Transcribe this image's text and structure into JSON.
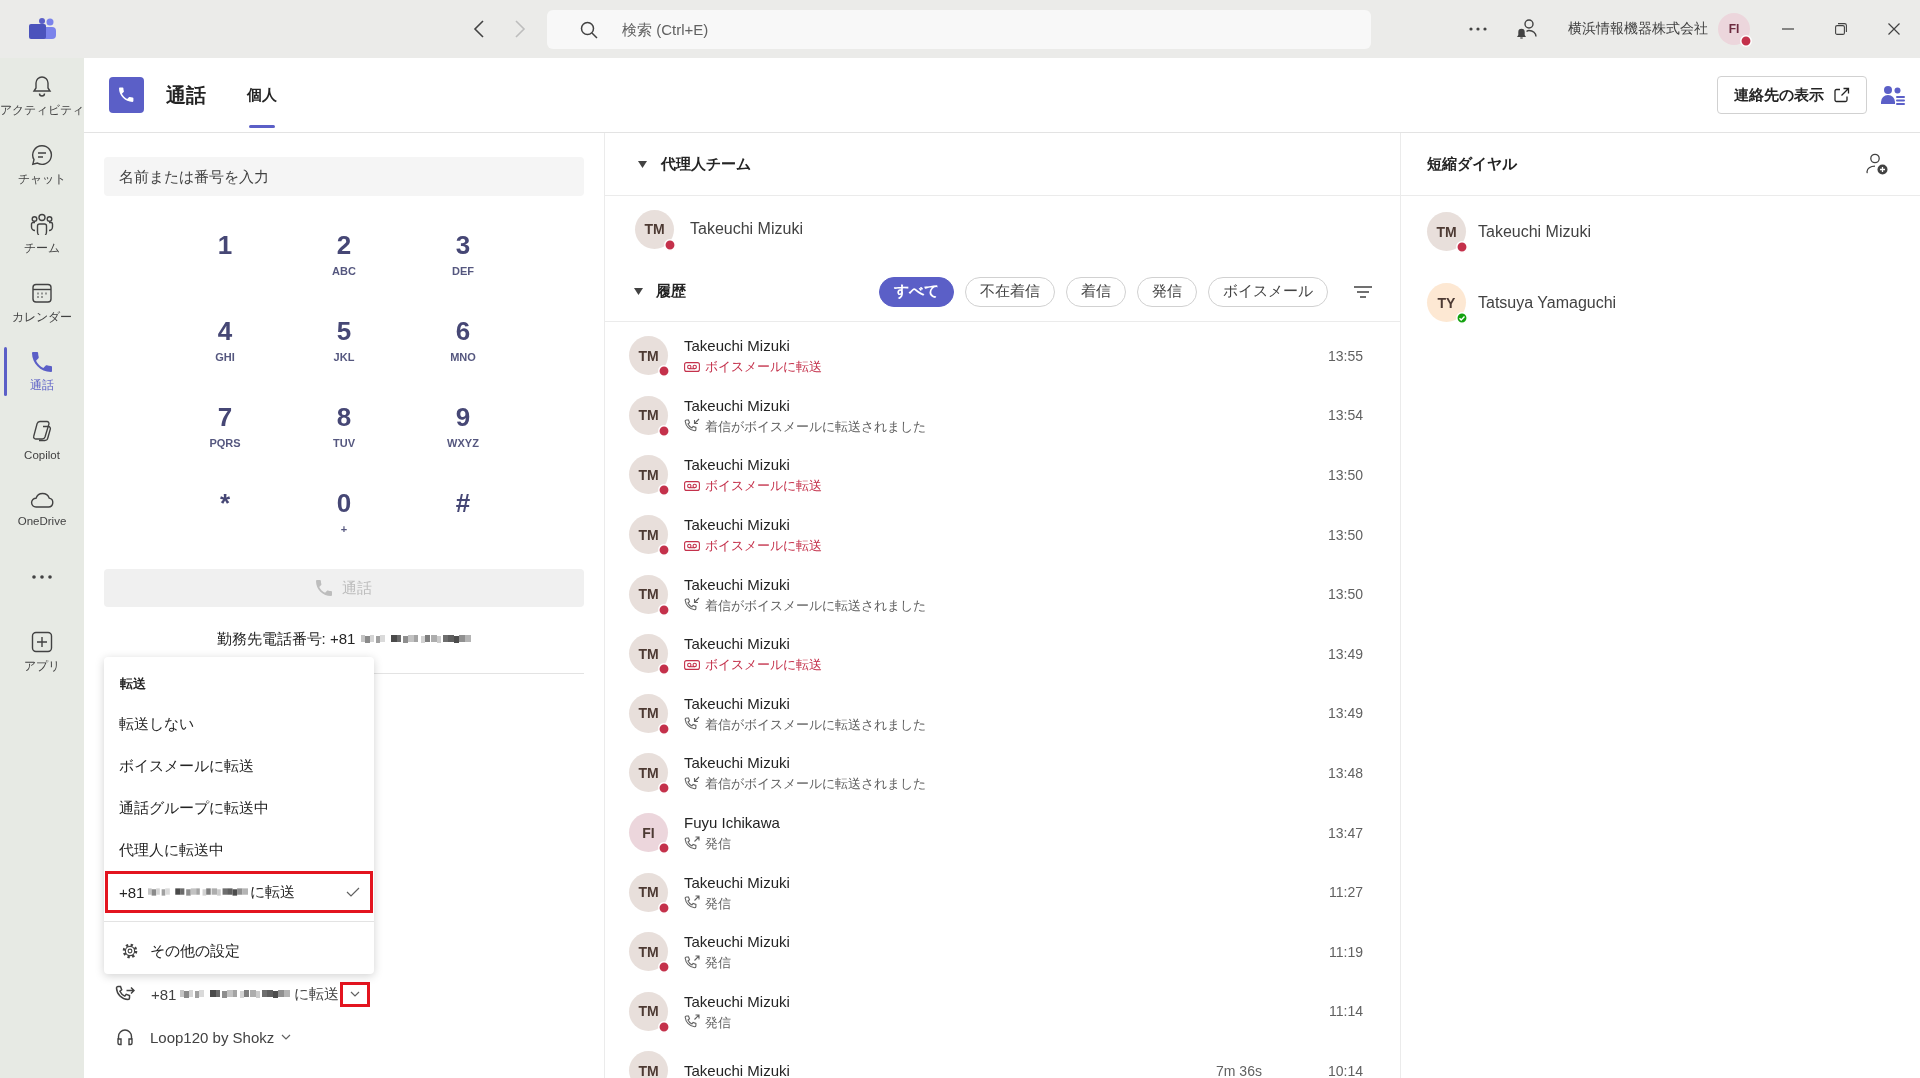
{
  "title_bar": {
    "search_placeholder": "検索 (Ctrl+E)",
    "org_name": "横浜情報機器株式会社",
    "user": {
      "avatar": {
        "initials": "FI",
        "color": "#ecd6dc"
      },
      "status": {
        "color": "#c4314b",
        "available": false
      }
    }
  },
  "app_rail": [
    {
      "kind": "activity",
      "label": "アクティビティ",
      "selected": false
    },
    {
      "kind": "chat",
      "label": "チャット",
      "selected": false
    },
    {
      "kind": "teams",
      "label": "チーム",
      "selected": false
    },
    {
      "kind": "calendar",
      "label": "カレンダー",
      "selected": false
    },
    {
      "kind": "calls",
      "label": "通話",
      "selected": true
    },
    {
      "kind": "copilot",
      "label": "Copilot",
      "selected": false
    },
    {
      "kind": "onedrive",
      "label": "OneDrive",
      "selected": false
    },
    {
      "kind": "more",
      "selected": false
    },
    {
      "kind": "apps",
      "label": "アプリ",
      "selected": false
    }
  ],
  "header": {
    "title": "通話",
    "tabs": [
      {
        "label": "個人",
        "selected": true
      }
    ],
    "contacts_button": "連絡先の表示"
  },
  "dialer": {
    "placeholder": "名前または番号を入力",
    "keys": [
      {
        "digit": "1"
      },
      {
        "digit": "2",
        "letters": "ABC"
      },
      {
        "digit": "3",
        "letters": "DEF"
      },
      {
        "digit": "4",
        "letters": "GHI"
      },
      {
        "digit": "5",
        "letters": "JKL"
      },
      {
        "digit": "6",
        "letters": "MNO"
      },
      {
        "digit": "7",
        "letters": "PQRS"
      },
      {
        "digit": "8",
        "letters": "TUV"
      },
      {
        "digit": "9",
        "letters": "WXYZ"
      },
      {
        "digit": "*"
      },
      {
        "digit": "0",
        "letters": "+"
      },
      {
        "digit": "#"
      }
    ],
    "call_button": {
      "label": "通話",
      "disabled": true
    },
    "work_number": "勤務先電話番号: +81"
  },
  "forward_menu": {
    "title": "転送",
    "items": [
      {
        "kind": "text",
        "label": "転送しない",
        "selected": false,
        "highlighted": false
      },
      {
        "kind": "text",
        "label": "ボイスメールに転送",
        "selected": false,
        "highlighted": false
      },
      {
        "kind": "text",
        "label": "通話グループに転送中",
        "selected": false,
        "highlighted": false
      },
      {
        "kind": "text",
        "label": "代理人に転送中",
        "selected": false,
        "highlighted": false
      },
      {
        "kind": "number",
        "label": "+81",
        "suffix": "に転送",
        "selected": true,
        "highlighted": true
      }
    ],
    "settings": "その他の設定"
  },
  "forwarding": {
    "label": "+81",
    "suffix": "に転送",
    "highlighted": true
  },
  "audio_device": "Loop120 by Shokz",
  "delegates": {
    "title": "代理人チーム",
    "expanded": true,
    "people": [
      {
        "avatar": {
          "initials": "TM",
          "color": "#e8dfdb"
        },
        "name": "Takeuchi Mizuki",
        "status": {
          "color": "#c4314b",
          "available": false
        }
      }
    ]
  },
  "history": {
    "title": "履歴",
    "expanded": true,
    "filters": [
      {
        "label": "すべて",
        "selected": true
      },
      {
        "label": "不在着信",
        "selected": false
      },
      {
        "label": "着信",
        "selected": false
      },
      {
        "label": "発信",
        "selected": false
      },
      {
        "label": "ボイスメール",
        "selected": false
      }
    ],
    "calls": [
      {
        "avatar": {
          "initials": "TM",
          "color": "#e8dfdb"
        },
        "name": "Takeuchi Mizuki",
        "status": {
          "color": "#c4314b",
          "available": false
        },
        "kind": "voicemail",
        "detail": "ボイスメールに転送",
        "time": "13:55"
      },
      {
        "avatar": {
          "initials": "TM",
          "color": "#e8dfdb"
        },
        "name": "Takeuchi Mizuki",
        "status": {
          "color": "#c4314b",
          "available": false
        },
        "kind": "forwarded",
        "detail": "着信がボイスメールに転送されました",
        "time": "13:54"
      },
      {
        "avatar": {
          "initials": "TM",
          "color": "#e8dfdb"
        },
        "name": "Takeuchi Mizuki",
        "status": {
          "color": "#c4314b",
          "available": false
        },
        "kind": "voicemail",
        "detail": "ボイスメールに転送",
        "time": "13:50"
      },
      {
        "avatar": {
          "initials": "TM",
          "color": "#e8dfdb"
        },
        "name": "Takeuchi Mizuki",
        "status": {
          "color": "#c4314b",
          "available": false
        },
        "kind": "voicemail",
        "detail": "ボイスメールに転送",
        "time": "13:50"
      },
      {
        "avatar": {
          "initials": "TM",
          "color": "#e8dfdb"
        },
        "name": "Takeuchi Mizuki",
        "status": {
          "color": "#c4314b",
          "available": false
        },
        "kind": "forwarded",
        "detail": "着信がボイスメールに転送されました",
        "time": "13:50"
      },
      {
        "avatar": {
          "initials": "TM",
          "color": "#e8dfdb"
        },
        "name": "Takeuchi Mizuki",
        "status": {
          "color": "#c4314b",
          "available": false
        },
        "kind": "voicemail",
        "detail": "ボイスメールに転送",
        "time": "13:49"
      },
      {
        "avatar": {
          "initials": "TM",
          "color": "#e8dfdb"
        },
        "name": "Takeuchi Mizuki",
        "status": {
          "color": "#c4314b",
          "available": false
        },
        "kind": "forwarded",
        "detail": "着信がボイスメールに転送されました",
        "time": "13:49"
      },
      {
        "avatar": {
          "initials": "TM",
          "color": "#e8dfdb"
        },
        "name": "Takeuchi Mizuki",
        "status": {
          "color": "#c4314b",
          "available": false
        },
        "kind": "forwarded",
        "detail": "着信がボイスメールに転送されました",
        "time": "13:48"
      },
      {
        "avatar": {
          "initials": "FI",
          "color": "#ecd6dc"
        },
        "name": "Fuyu Ichikawa",
        "status": {
          "color": "#c4314b",
          "available": false
        },
        "kind": "outgoing",
        "detail": "発信",
        "time": "13:47"
      },
      {
        "avatar": {
          "initials": "TM",
          "color": "#e8dfdb"
        },
        "name": "Takeuchi Mizuki",
        "status": {
          "color": "#c4314b",
          "available": false
        },
        "kind": "outgoing",
        "detail": "発信",
        "time": "11:27"
      },
      {
        "avatar": {
          "initials": "TM",
          "color": "#e8dfdb"
        },
        "name": "Takeuchi Mizuki",
        "status": {
          "color": "#c4314b",
          "available": false
        },
        "kind": "outgoing",
        "detail": "発信",
        "time": "11:19"
      },
      {
        "avatar": {
          "initials": "TM",
          "color": "#e8dfdb"
        },
        "name": "Takeuchi Mizuki",
        "status": {
          "color": "#c4314b",
          "available": false
        },
        "kind": "outgoing",
        "detail": "発信",
        "time": "11:14"
      },
      {
        "avatar": {
          "initials": "TM",
          "color": "#e8dfdb"
        },
        "name": "Takeuchi Mizuki",
        "duration": "7m 36s",
        "time": "10:14"
      }
    ]
  },
  "speed_dial": {
    "title": "短縮ダイヤル",
    "contacts": [
      {
        "avatar": {
          "initials": "TM",
          "color": "#e8dfdb"
        },
        "name": "Takeuchi Mizuki",
        "status": {
          "color": "#c4314b",
          "available": false
        }
      },
      {
        "avatar": {
          "initials": "TY",
          "color": "#fde8d3"
        },
        "name": "Tatsuya Yamaguchi",
        "status": {
          "color": "#13a10e",
          "available": true
        }
      }
    ]
  }
}
